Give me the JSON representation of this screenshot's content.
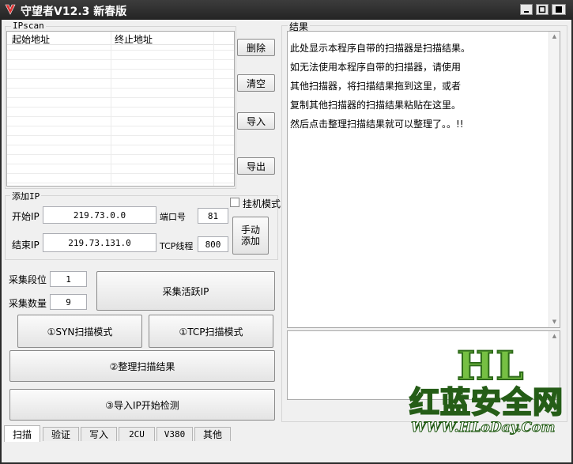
{
  "window": {
    "title": "守望者V12.3 新春版",
    "controls": [
      "minimize",
      "maximize",
      "close"
    ]
  },
  "ipscan": {
    "group_label": "IPscan",
    "columns": [
      "起始地址",
      "终止地址"
    ],
    "buttons": {
      "delete": "删除",
      "clear": "清空",
      "import": "导入",
      "export": "导出"
    }
  },
  "add_ip": {
    "group_label": "添加IP",
    "start_ip_label": "开始IP",
    "start_ip_value": "219.73.0.0",
    "end_ip_label": "结束IP",
    "end_ip_value": "219.73.131.0",
    "port_label": "端口号",
    "port_value": "81",
    "tcp_threads_label": "TCP线程",
    "tcp_threads_value": "800",
    "hangup_mode_label": "挂机模式",
    "hangup_mode_checked": false,
    "manual_add_line1": "手动",
    "manual_add_line2": "添加"
  },
  "collect": {
    "segment_label": "采集段位",
    "segment_value": "1",
    "count_label": "采集数量",
    "count_value": "9",
    "collect_active_ip": "采集活跃IP"
  },
  "actions": {
    "syn_mode": "①SYN扫描模式",
    "tcp_mode": "①TCP扫描模式",
    "organize_results": "②整理扫描结果",
    "import_start": "③导入IP开始检测"
  },
  "results": {
    "group_label": "结果",
    "lines": [
      "此处显示本程序自带的扫描器是扫描结果。",
      "如无法使用本程序自带的扫描器，请使用",
      "其他扫描器，将扫描结果拖到这里，或者",
      "复制其他扫描器的扫描结果粘贴在这里。",
      "然后点击整理扫描结果就可以整理了。。!!"
    ]
  },
  "tabs": [
    "扫描",
    "验证",
    "写入",
    "2CU",
    "V380",
    "其他"
  ],
  "active_tab": "扫描",
  "watermark": {
    "logo": "HL",
    "name": "红蓝安全网",
    "url": "WWW.HLoDay.Com"
  },
  "colors": {
    "titlebar": "#2a2a2a",
    "client_bg": "#f0f0f0",
    "watermark_green": "#76c043"
  }
}
